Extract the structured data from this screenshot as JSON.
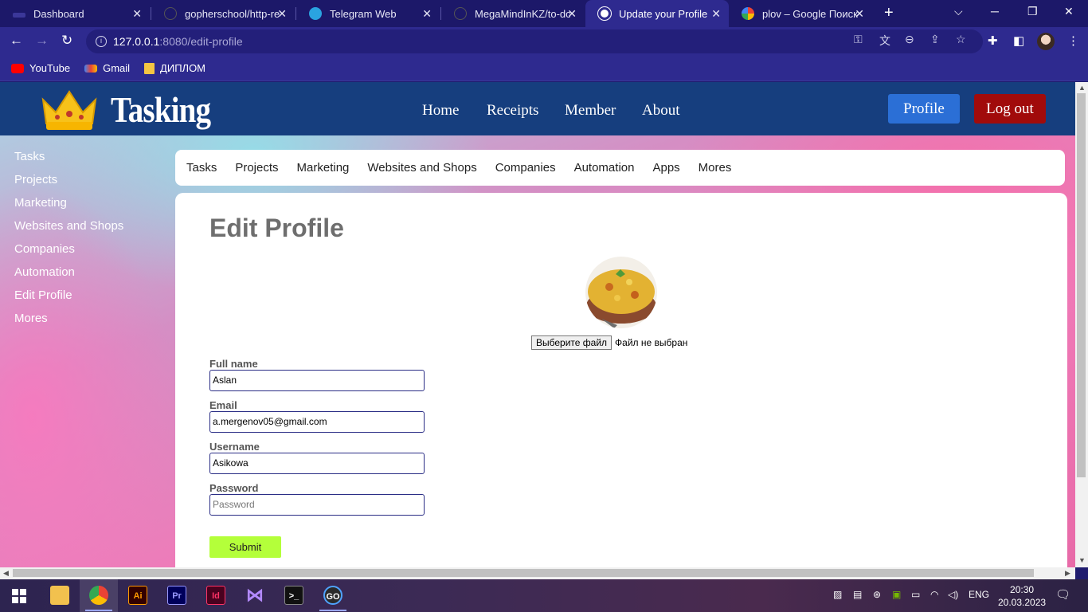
{
  "browser": {
    "tabs": [
      {
        "title": "Dashboard",
        "active": false
      },
      {
        "title": "gopherschool/http-re",
        "active": false
      },
      {
        "title": "Telegram Web",
        "active": false
      },
      {
        "title": "MegaMindInKZ/to-do",
        "active": false
      },
      {
        "title": "Update your Profile",
        "active": true
      },
      {
        "title": "plov – Google Поиск",
        "active": false
      }
    ],
    "url_host": "127.0.0.1",
    "url_path": ":8080/edit-profile",
    "bookmarks": [
      {
        "label": "YouTube",
        "color": "#ff0000"
      },
      {
        "label": "Gmail",
        "color": "#ea4335"
      },
      {
        "label": "ДИПЛОМ",
        "color": "#f5c542"
      }
    ]
  },
  "site": {
    "brand": "Tasking",
    "nav": [
      "Home",
      "Receipts",
      "Member",
      "About"
    ],
    "profile_label": "Profile",
    "logout_label": "Log out",
    "sidebar": [
      "Tasks",
      "Projects",
      "Marketing",
      "Websites and Shops",
      "Companies",
      "Automation",
      "Edit Profile",
      "Mores"
    ],
    "subnav": [
      "Tasks",
      "Projects",
      "Marketing",
      "Websites and Shops",
      "Companies",
      "Automation",
      "Apps",
      "Mores"
    ]
  },
  "form": {
    "title": "Edit Profile",
    "file_button": "Выберите файл",
    "file_status": "Файл не выбран",
    "fields": [
      {
        "label": "Full name",
        "value": "Aslan",
        "placeholder": ""
      },
      {
        "label": "Email",
        "value": "a.mergenov05@gmail.com",
        "placeholder": ""
      },
      {
        "label": "Username",
        "value": "Asikowa",
        "placeholder": ""
      },
      {
        "label": "Password",
        "value": "",
        "placeholder": "Password"
      }
    ],
    "submit_label": "Submit"
  },
  "taskbar": {
    "lang": "ENG",
    "time": "20:30",
    "date": "20.03.2023",
    "apps": [
      "Ai",
      "Pr",
      "Id"
    ]
  },
  "colors": {
    "header": "#163e7e",
    "profile_button": "#2b6fd6",
    "logout_button": "#a10b0b",
    "submit_button": "#b4ff3a",
    "browser_frame": "#2e2a8f"
  }
}
